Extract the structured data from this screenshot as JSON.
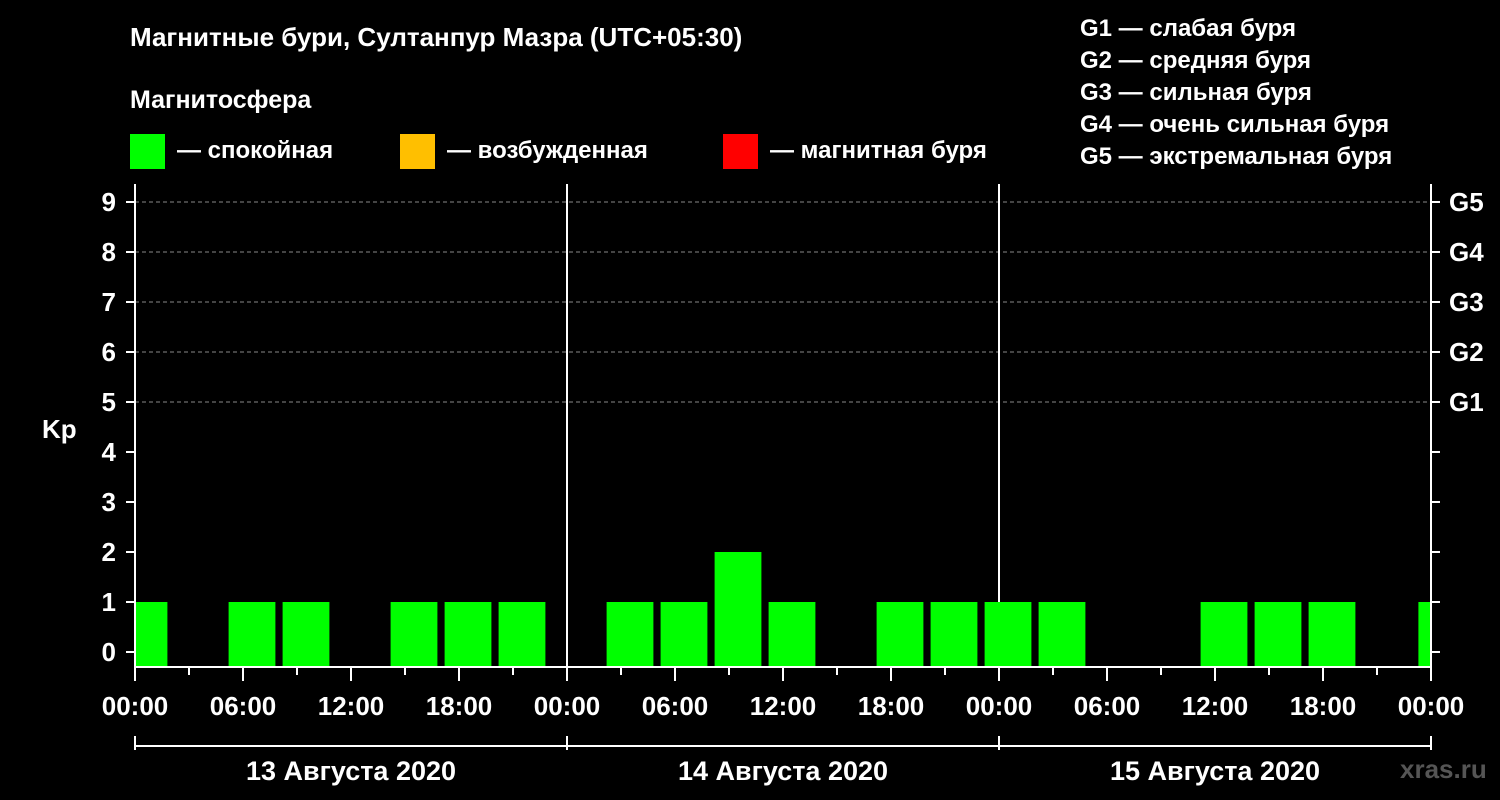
{
  "title": "Магнитные бури, Султанпур Мазра (UTC+05:30)",
  "magnetosphere": {
    "title": "Магнитосфера",
    "items": [
      {
        "label": "— спокойная",
        "color": "#00ff00"
      },
      {
        "label": "— возбужденная",
        "color": "#ffbf00"
      },
      {
        "label": "— магнитная буря",
        "color": "#ff0000"
      }
    ]
  },
  "storm_levels": [
    "G1 — слабая буря",
    "G2 — средняя буря",
    "G3 — сильная буря",
    "G4 — очень сильная буря",
    "G5 — экстремальная буря"
  ],
  "watermark": "xras.ru",
  "chart_data": {
    "type": "bar",
    "ylabel": "Kp",
    "ylim": [
      0,
      9
    ],
    "yticks": [
      "0",
      "1",
      "2",
      "3",
      "4",
      "5",
      "6",
      "7",
      "8",
      "9"
    ],
    "right_ticks": [
      {
        "value": 5,
        "label": "G1"
      },
      {
        "value": 6,
        "label": "G2"
      },
      {
        "value": 7,
        "label": "G3"
      },
      {
        "value": 8,
        "label": "G4"
      },
      {
        "value": 9,
        "label": "G5"
      }
    ],
    "grid": "dashed horizontal at Kp 5-9",
    "xlim_hours": [
      0,
      72
    ],
    "xtick_labels": [
      "00:00",
      "06:00",
      "12:00",
      "18:00",
      "00:00",
      "06:00",
      "12:00",
      "18:00",
      "00:00",
      "06:00",
      "12:00",
      "18:00",
      "00:00"
    ],
    "days": [
      "13 Августа 2020",
      "14 Августа 2020",
      "15 Августа 2020"
    ],
    "bar_color": "#00ff00",
    "bars": [
      {
        "start": 0.0,
        "end": 1.8,
        "kp": 1
      },
      {
        "start": 5.2,
        "end": 7.8,
        "kp": 1
      },
      {
        "start": 8.2,
        "end": 10.8,
        "kp": 1
      },
      {
        "start": 14.2,
        "end": 16.8,
        "kp": 1
      },
      {
        "start": 17.2,
        "end": 19.8,
        "kp": 1
      },
      {
        "start": 20.2,
        "end": 22.8,
        "kp": 1
      },
      {
        "start": 26.2,
        "end": 28.8,
        "kp": 1
      },
      {
        "start": 29.2,
        "end": 31.8,
        "kp": 1
      },
      {
        "start": 32.2,
        "end": 34.8,
        "kp": 2
      },
      {
        "start": 35.2,
        "end": 37.8,
        "kp": 1
      },
      {
        "start": 41.2,
        "end": 43.8,
        "kp": 1
      },
      {
        "start": 44.2,
        "end": 46.8,
        "kp": 1
      },
      {
        "start": 47.2,
        "end": 49.8,
        "kp": 1
      },
      {
        "start": 50.2,
        "end": 52.8,
        "kp": 1
      },
      {
        "start": 59.2,
        "end": 61.8,
        "kp": 1
      },
      {
        "start": 62.2,
        "end": 64.8,
        "kp": 1
      },
      {
        "start": 65.2,
        "end": 67.8,
        "kp": 1
      },
      {
        "start": 71.3,
        "end": 72.0,
        "kp": 1
      }
    ]
  }
}
